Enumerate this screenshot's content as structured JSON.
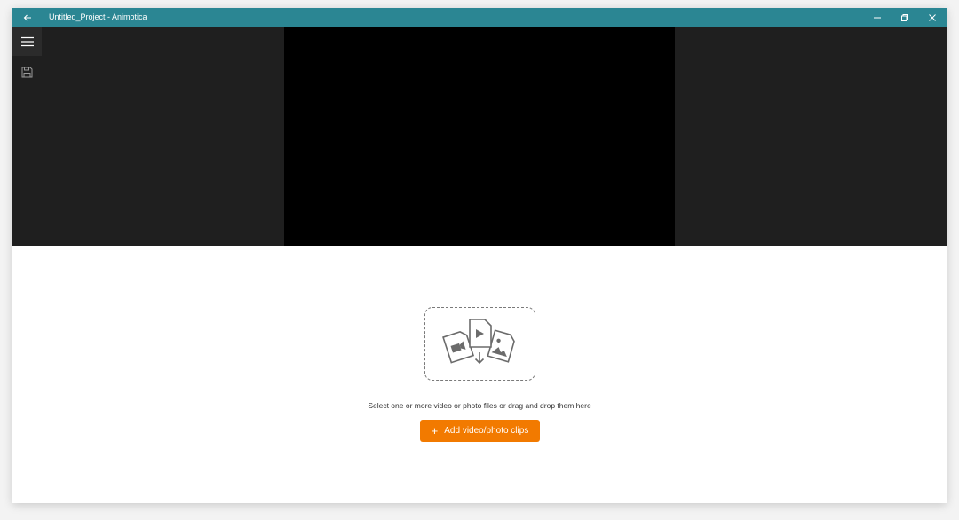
{
  "window": {
    "title": "Untitled_Project - Animotica"
  },
  "titlebar_buttons": {
    "back": "arrow-left-icon",
    "minimize": "minimize-icon",
    "restore": "restore-icon",
    "close": "close-icon"
  },
  "sidebar": {
    "menu_icon": "hamburger-menu-icon",
    "save_icon": "save-icon"
  },
  "empty_state": {
    "hint": "Select one or more video or photo files or drag and drop them here",
    "add_button_label": "Add video/photo clips"
  },
  "colors": {
    "titlebar": "#2b8693",
    "preview_background": "#1f1f1f",
    "video_frame": "#000000",
    "accent_button": "#f27a00"
  }
}
